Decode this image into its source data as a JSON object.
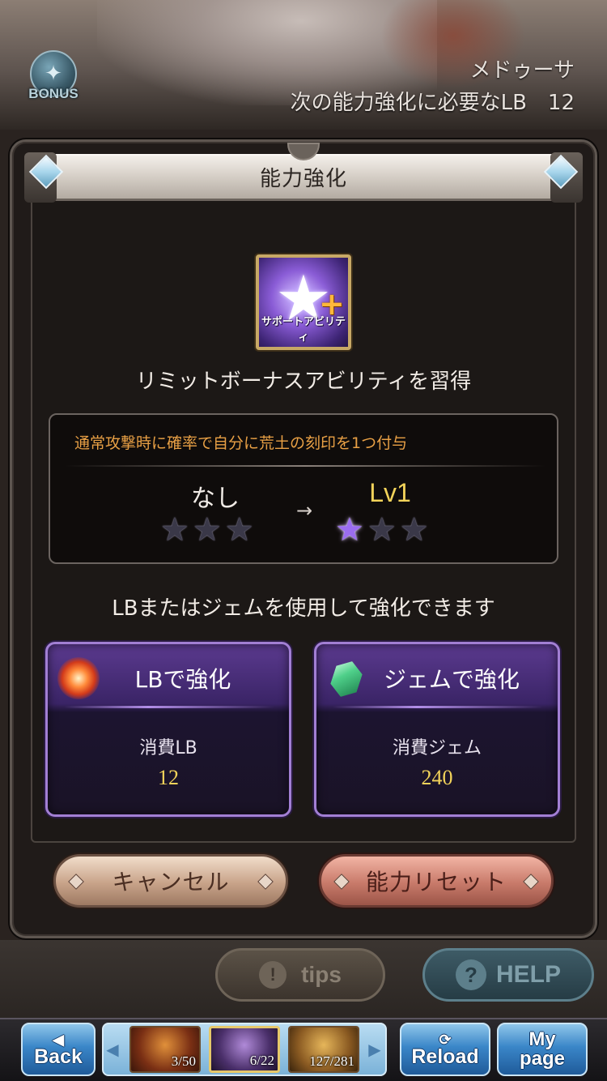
{
  "header": {
    "bonus_label": "BONUS",
    "character_name": "メドゥーサ",
    "next_lb_text": "次の能力強化に必要なLB　12"
  },
  "dialog": {
    "title": "能力強化",
    "ability_icon_caption": "サポートアビリティ",
    "acquire_text": "リミットボーナスアビリティを習得",
    "description": "通常攻撃時に確率で自分に荒土の刻印を1つ付与",
    "level_from": "なし",
    "level_to": "Lv1",
    "arrow": "→",
    "stars_from_filled": 0,
    "stars_to_filled": 1,
    "stars_total": 3,
    "use_text": "LBまたはジェムを使用して強化できます",
    "lb_option": {
      "title": "LBで強化",
      "cost_label": "消費LB",
      "cost_value": "12"
    },
    "gem_option": {
      "title": "ジェムで強化",
      "cost_label": "消費ジェム",
      "cost_value": "240"
    },
    "cancel_label": "キャンセル",
    "reset_label": "能力リセット"
  },
  "footer": {
    "tips_label": "tips",
    "help_label": "HELP"
  },
  "nav": {
    "back_label": "Back",
    "reload_label": "Reload",
    "mypage_label": "My page",
    "resources": [
      {
        "value": "3/50"
      },
      {
        "value": "6/22"
      },
      {
        "value": "127/281"
      }
    ]
  },
  "colors": {
    "accent_gold": "#f2d35a",
    "description_orange": "#e8a045",
    "card_purple": "#3a2466",
    "nav_blue": "#3a86c8"
  }
}
